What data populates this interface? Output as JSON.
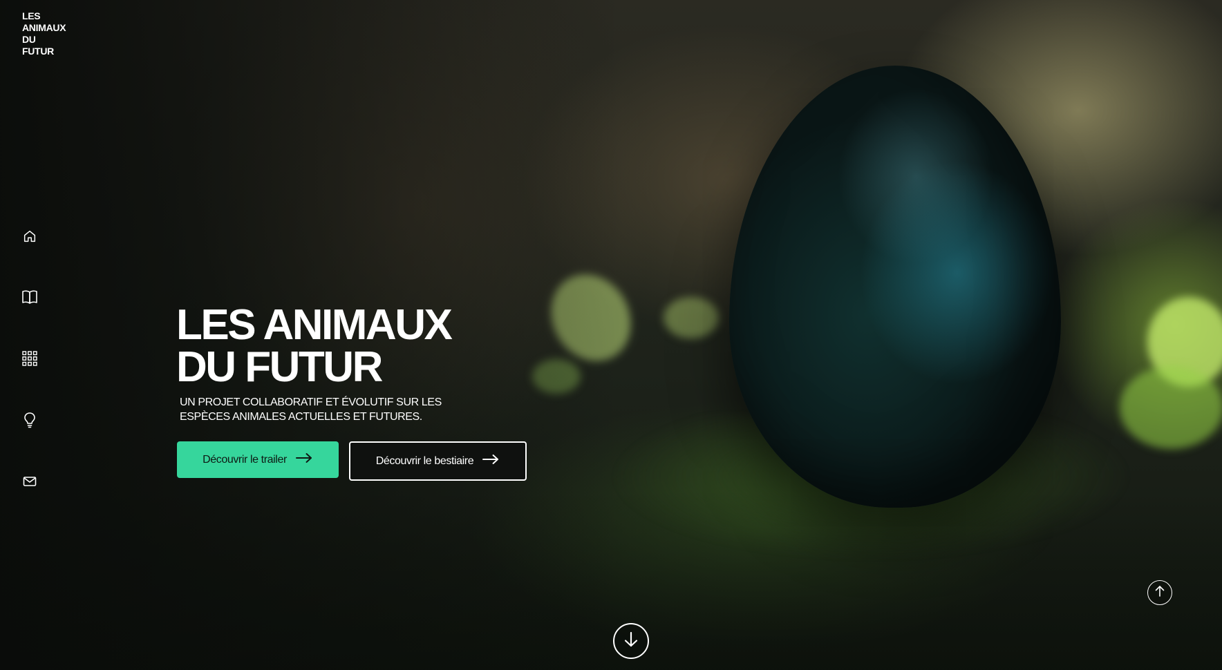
{
  "brand": {
    "logo_line1": "LES ANIMAUX",
    "logo_line2": "DU FUTUR"
  },
  "sidebar": {
    "items": [
      {
        "label": "Accueil",
        "icon": "home-icon"
      },
      {
        "label": "Bestiaire",
        "icon": "book-icon"
      },
      {
        "label": "Galerie",
        "icon": "grid-icon"
      },
      {
        "label": "Idées",
        "icon": "lightbulb-icon"
      },
      {
        "label": "Contact",
        "icon": "mail-icon"
      }
    ]
  },
  "hero": {
    "title_line1": "LES ANIMAUX",
    "title_line2": "DU FUTUR",
    "subtitle_line1": "UN PROJET COLLABORATIF ET ÉVOLUTIF SUR LES",
    "subtitle_line2": "ESPÈCES ANIMALES ACTUELLES ET FUTURES.",
    "primary_button": "Découvrir le trailer",
    "secondary_button": "Découvrir le bestiaire"
  },
  "controls": {
    "scroll_down_icon": "arrow-down-icon",
    "back_to_top_icon": "arrow-up-icon"
  },
  "colors": {
    "accent": "#36d69c",
    "background": "#0c0f0d",
    "text": "#ffffff"
  }
}
